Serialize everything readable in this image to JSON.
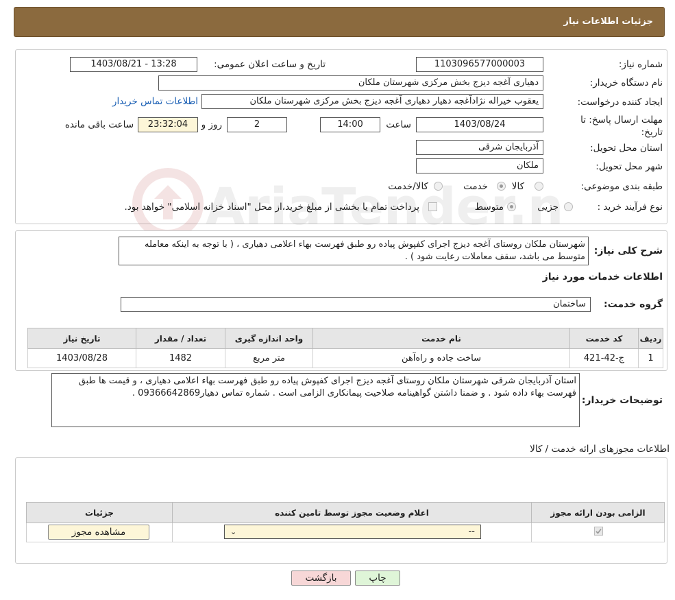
{
  "header": {
    "title": "جزئیات اطلاعات نیاز"
  },
  "form": {
    "need_number_label": "شماره نیاز:",
    "need_number": "1103096577000003",
    "announce_label": "تاریخ و ساعت اعلان عمومی:",
    "announce_value": "1403/08/21 - 13:28",
    "buyer_org_label": "نام دستگاه خریدار:",
    "buyer_org": "دهیاری آغجه دیزج بخش مرکزی شهرستان ملکان",
    "creator_label": "ایجاد کننده درخواست:",
    "creator": "یعقوب خیراله نژادآغجه دهیار دهیاری آغجه دیزج بخش مرکزی شهرستان ملکان",
    "contact_link": "اطلاعات تماس خریدار",
    "deadline_label": "مهلت ارسال پاسخ: تا تاریخ:",
    "deadline_date": "1403/08/24",
    "time_label": "ساعت",
    "deadline_time": "14:00",
    "days": "2",
    "days_label": "روز و",
    "remaining_time": "23:32:04",
    "remaining_label": "ساعت باقی مانده",
    "province_label": "استان محل تحویل:",
    "province": "آذربایجان شرقی",
    "city_label": "شهر محل تحویل:",
    "city": "ملکان",
    "category_label": "طبقه بندی موضوعی:",
    "category_options": [
      "کالا",
      "خدمت",
      "کالا/خدمت"
    ],
    "category_selected": "خدمت",
    "process_label": "نوع فرآیند خرید :",
    "process_options": [
      "جزیی",
      "متوسط"
    ],
    "process_selected": "متوسط",
    "payment_note": "پرداخت تمام یا بخشی از مبلغ خرید،از محل \"اسناد خزانه اسلامی\" خواهد بود."
  },
  "summary": {
    "label": "شرح کلی نیاز:",
    "text": "شهرستان ملکان روستای آغجه دیزج اجرای کفپوش پیاده رو  طبق فهرست بهاء اعلامی دهیاری ، ( با توجه به اینکه معامله متوسط می باشد، سقف معاملات رعایت شود ) ."
  },
  "services": {
    "title": "اطلاعات خدمات مورد نیاز",
    "group_label": "گروه خدمت:",
    "group_value": "ساختمان",
    "columns": [
      "ردیف",
      "کد خدمت",
      "نام خدمت",
      "واحد اندازه گیری",
      "تعداد / مقدار",
      "تاریخ نیاز"
    ],
    "rows": [
      [
        "1",
        "ج-42-421",
        "ساخت جاده و راه‌آهن",
        "متر مربع",
        "1482",
        "1403/08/28"
      ]
    ]
  },
  "buyer_notes": {
    "label": "توضیحات خریدار:",
    "text": "استان آذربایجان شرقی شهرستان ملکان روستای آغجه دیزج اجرای کفپوش پیاده رو  طبق فهرست بهاء اعلامی دهیاری ، و قیمت ها طبق فهرست بهاء داده شود . و ضمنا داشتن گواهینامه صلاحیت پیمانکاری الزامی است . شماره تماس دهیار09366642869 ."
  },
  "permits": {
    "title": "اطلاعات مجوزهای ارائه خدمت / کالا",
    "columns": [
      "الزامی بودن ارائه مجوز",
      "اعلام وضعیت مجوز توسط تامین کننده",
      "جزئیات"
    ],
    "select_value": "--",
    "view_button": "مشاهده مجوز"
  },
  "buttons": {
    "print": "چاپ",
    "back": "بازگشت"
  },
  "watermark": {
    "text": "AriaTender.neT"
  },
  "colors": {
    "header_bg": "#8b6a3e",
    "link": "#1a5fb4",
    "back_btn": "#f7d7d7",
    "print_btn": "#dff5d8"
  }
}
